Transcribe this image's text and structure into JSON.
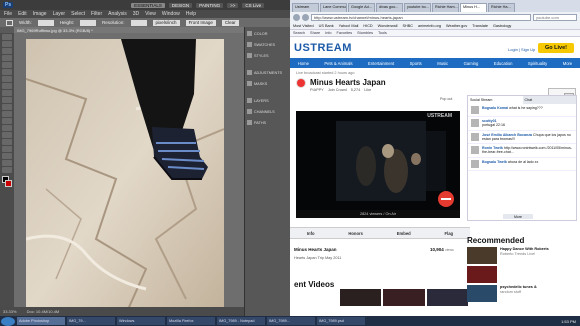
{
  "photoshop": {
    "logo": "Ps",
    "workspaces": [
      "ESSENTIALS",
      "DESIGN",
      "PAINTING",
      ">>"
    ],
    "active_workspace": "ESSENTIALS",
    "cs_live": "CS Live",
    "menu": [
      "File",
      "Edit",
      "Image",
      "Layer",
      "Select",
      "Filter",
      "Analysis",
      "3D",
      "View",
      "Window",
      "Help"
    ],
    "options": {
      "feather_label": "Width:",
      "height_label": "Height:",
      "resolution_label": "Resolution:",
      "resolution_unit": "pixels/inch",
      "front_image": "Front Image",
      "clear": "Clear"
    },
    "doc_tab": "IMG_7969Ruffhwo.jpg @ 33.3% (RGB/8) *",
    "panels": [
      "COLOR",
      "SWATCHES",
      "STYLES",
      "ADJUSTMENTS",
      "MASKS",
      "LAYERS",
      "CHANNELS",
      "PATHS"
    ],
    "status": {
      "zoom": "33.33%",
      "doc": "Doc: 10.4M/10.4M"
    }
  },
  "browser": {
    "tabs": [
      "Ustream",
      "Lane Communi...",
      "Google Ad...",
      "divas goo...",
      "youtube bo...",
      "Richie Ham...",
      "Minus H...",
      "Richie Ha..."
    ],
    "active_tab": 6,
    "url": "http://www.ustream.tv/channel/minus-hearts-japan",
    "search_placeholder": "youtube.com",
    "bookmarks": [
      "Most Visited",
      "US Bank",
      "Yahoo! Mail",
      "HICD",
      "Wonderwall",
      "SHBC",
      "animeinfo.org",
      "Weather.gov",
      "Translate",
      "Gastrology"
    ],
    "toolbar": [
      "Search",
      "Share",
      "Info",
      "Favorites",
      "Stumbles",
      "Tools"
    ],
    "site": {
      "logo": "USTREAM",
      "login": "Login | Sign Up",
      "golive": "Go Live!",
      "nav": [
        "Home",
        "Pets & Animals",
        "Entertainment",
        "Sports",
        "Music",
        "Gaming",
        "Education",
        "Spirituality",
        "More"
      ],
      "live_meta": "Live broadcast started 2 hours ago",
      "channel_title": "Minus Hearts Japan",
      "channel_sub": [
        "PIAPPY",
        "Join Crowd",
        "5,274",
        "Like"
      ],
      "popout": "Pop out",
      "player_watermark": "USTREAM",
      "viewers": "2824 viewers / On Air",
      "tabs": [
        "Info",
        "Honors",
        "Embed",
        "Flag"
      ],
      "show_title": "Minus Hearts Japan",
      "views_count": "10,904",
      "views_label": "views",
      "show_sub": "Hearts Japan Trip May 2011",
      "recent_heading": "ent Videos",
      "chat": {
        "tabs": [
          "Social Stream",
          "Chat"
        ],
        "messages": [
          {
            "user": "Bogsalu Komai",
            "text": "what is he saying???"
          },
          {
            "user": "scotty01",
            "text": "portugal 22:16"
          },
          {
            "user": "José Emilio Albarch Bocanza",
            "text": "Chupa que los japos no estan para bromas!!!"
          },
          {
            "user": "Ronin Twelk",
            "text": "http://www.ronintwelk.com /2011/05/minus-the-bear-free-chat..."
          },
          {
            "user": "Bogsalu Twelk",
            "text": "ahora de al lado xx"
          }
        ],
        "more": "More"
      },
      "search_btn": "Sign",
      "recommended_heading": "Recommended",
      "recommended": [
        {
          "title": "Happy Dance With Roberts",
          "sub": "Roberto Trends Live!"
        },
        {
          "title": "",
          "sub": ""
        },
        {
          "title": "psychedelic tunes &",
          "sub": "random stuff"
        }
      ]
    }
  },
  "taskbar": {
    "items": [
      "Start",
      "Adobe Photoshop",
      "IMG_79...",
      "Windows",
      "Mozilla Firefox",
      "IMG_7989 - Notepad",
      "IMG_7989...",
      "IMG_7989.psd"
    ],
    "clock": "1:53 PM"
  }
}
